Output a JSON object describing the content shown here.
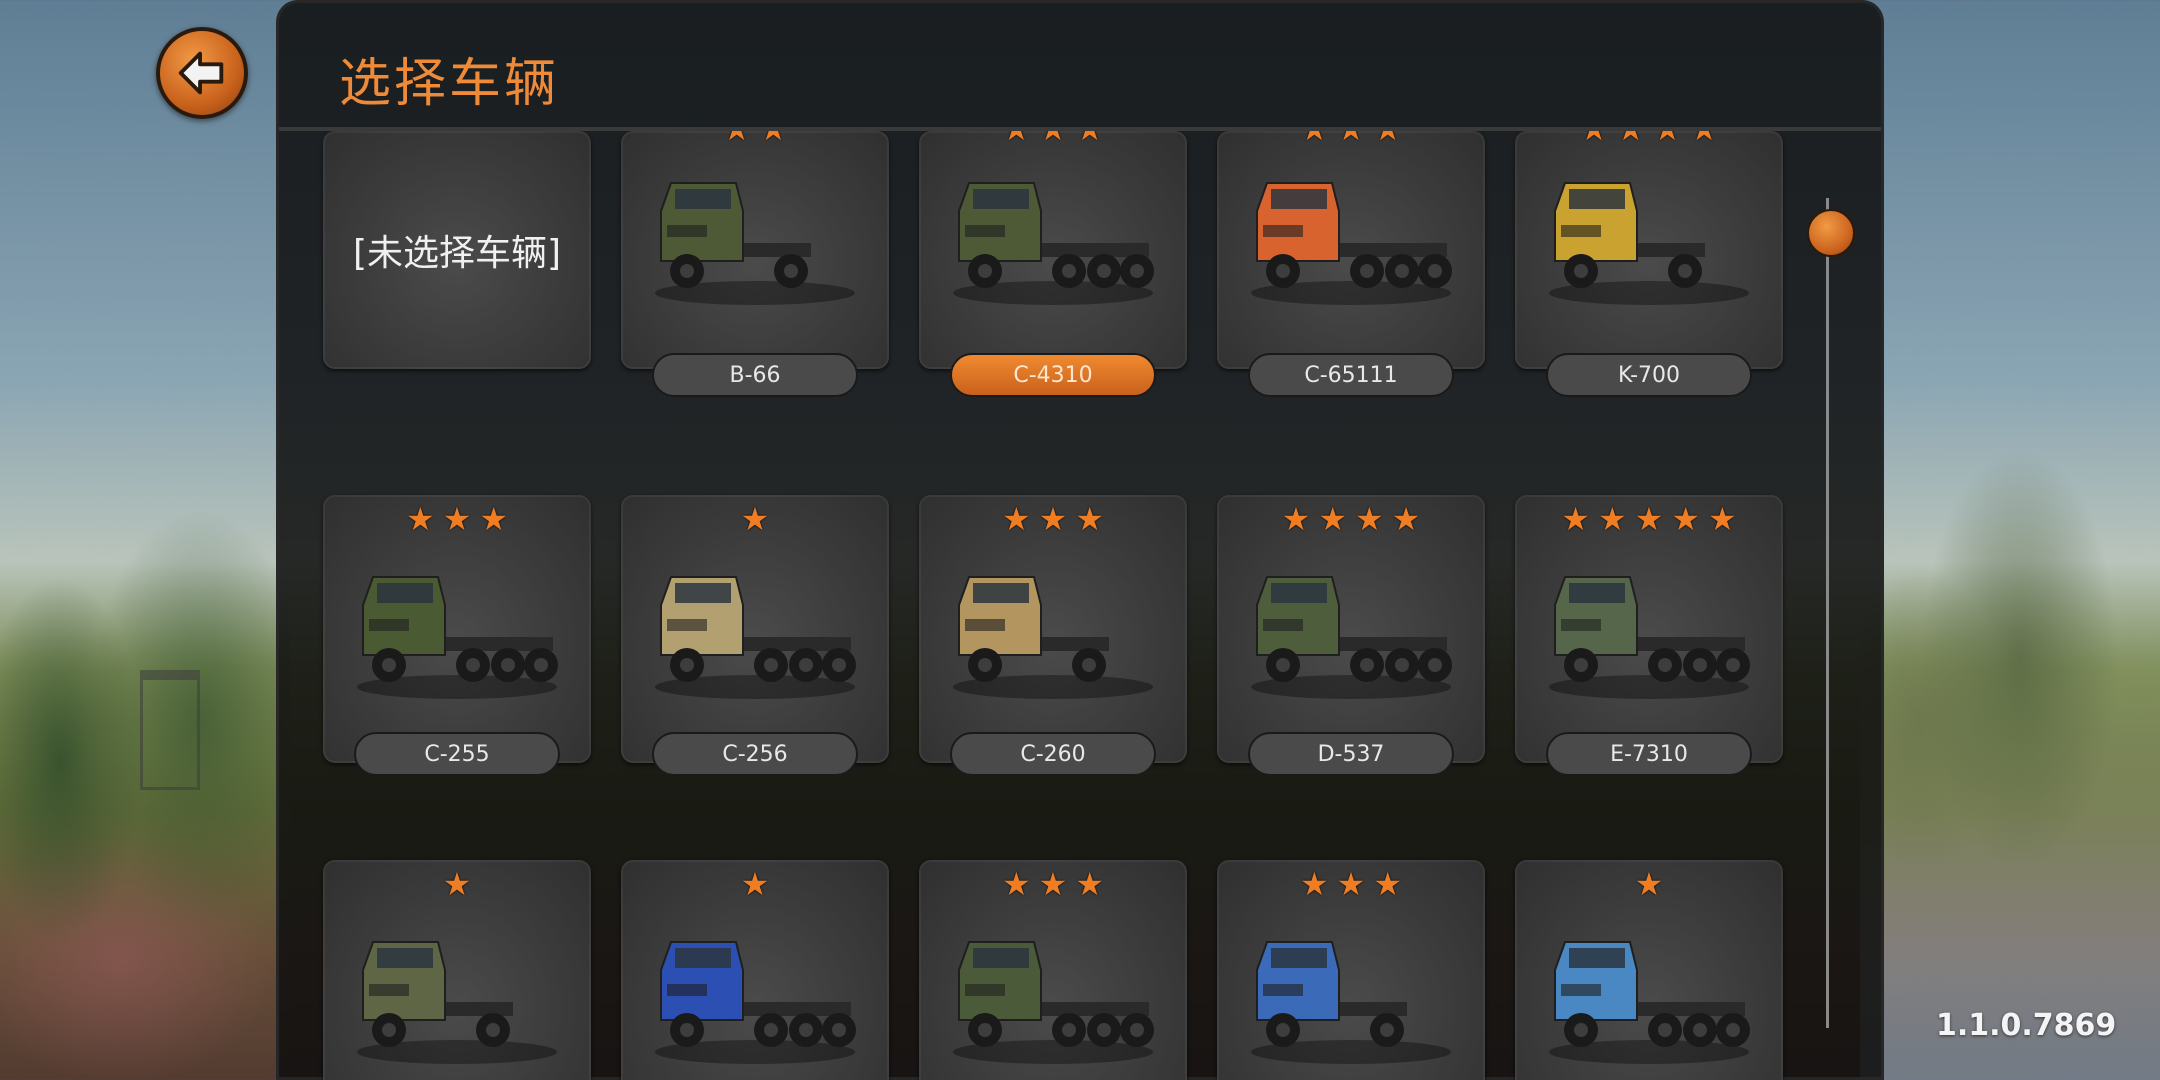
{
  "header": {
    "title": "选择车辆"
  },
  "empty_slot": {
    "label": "[未选择车辆]"
  },
  "vehicles": [
    {
      "name": "B-66",
      "stars": 2,
      "color": "#4d5a35",
      "selected": false
    },
    {
      "name": "C-4310",
      "stars": 3,
      "color": "#4d5a35",
      "selected": true
    },
    {
      "name": "C-65111",
      "stars": 3,
      "color": "#d8632f",
      "selected": false
    },
    {
      "name": "K-700",
      "stars": 4,
      "color": "#c9a230",
      "selected": false
    },
    {
      "name": "C-255",
      "stars": 3,
      "color": "#4a5a32",
      "selected": false
    },
    {
      "name": "C-256",
      "stars": 1,
      "color": "#b3a070",
      "selected": false
    },
    {
      "name": "C-260",
      "stars": 3,
      "color": "#b39560",
      "selected": false
    },
    {
      "name": "D-537",
      "stars": 4,
      "color": "#4e5e3c",
      "selected": false
    },
    {
      "name": "E-7310",
      "stars": 5,
      "color": "#55664a",
      "selected": false
    },
    {
      "name": "",
      "stars": 1,
      "color": "#5e6646",
      "selected": false
    },
    {
      "name": "",
      "stars": 1,
      "color": "#2b4fb3",
      "selected": false
    },
    {
      "name": "",
      "stars": 3,
      "color": "#4b5a38",
      "selected": false
    },
    {
      "name": "",
      "stars": 3,
      "color": "#3a6ab8",
      "selected": false
    },
    {
      "name": "",
      "stars": 1,
      "color": "#4a88c4",
      "selected": false
    }
  ],
  "version": "1.1.0.7869",
  "colors": {
    "accent": "#ef8a38",
    "star": "#ef7d24",
    "panel": "#0e0e0e"
  },
  "icons": {
    "back": "arrow-left-icon",
    "star": "star-icon",
    "truck": "truck-icon"
  }
}
